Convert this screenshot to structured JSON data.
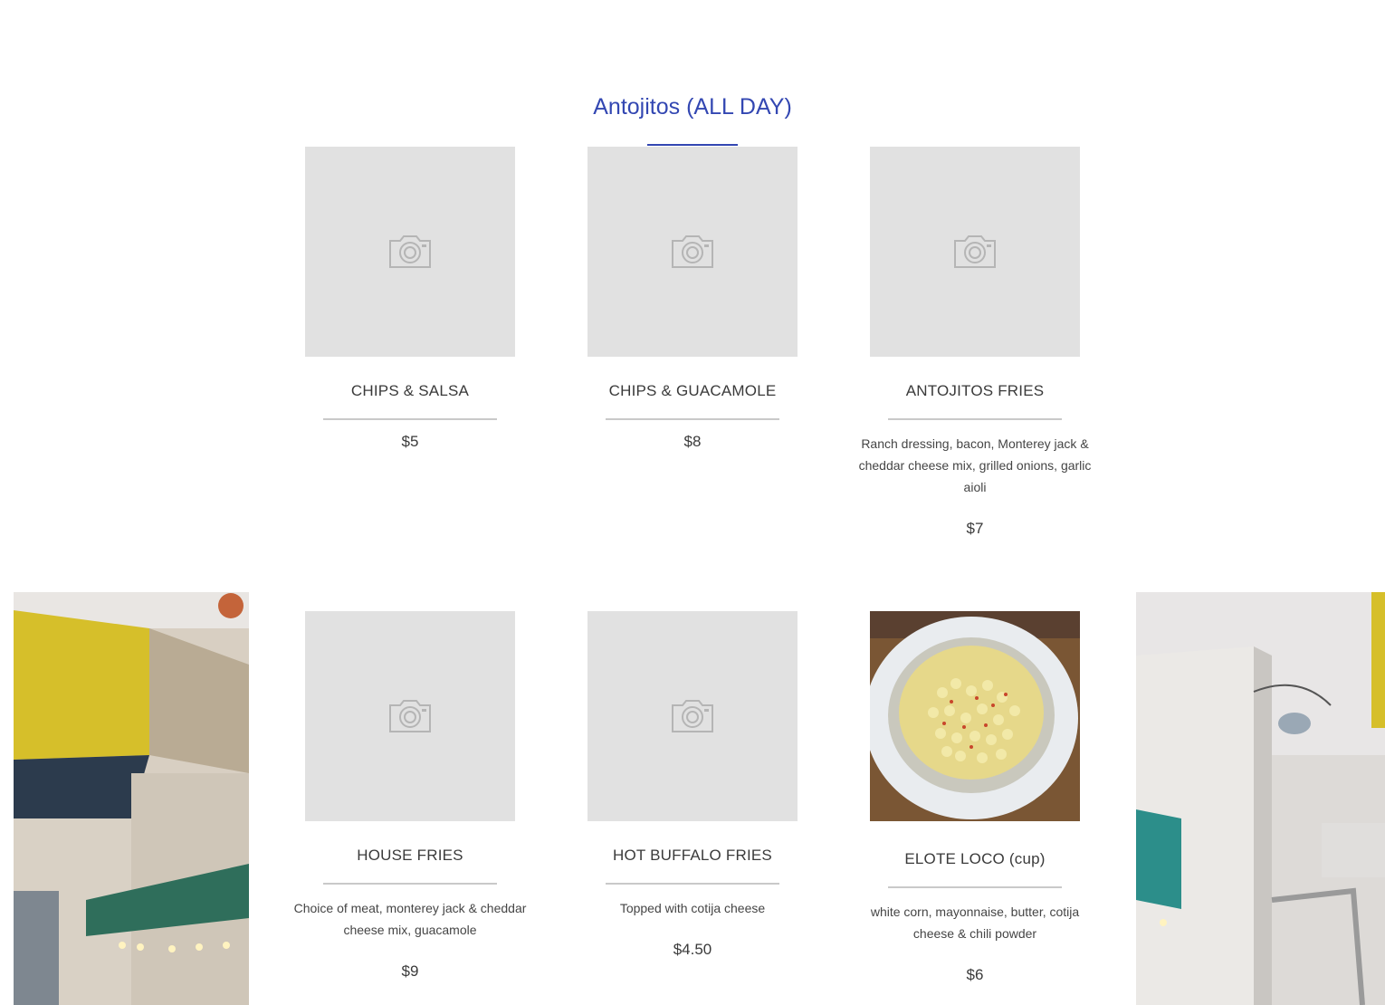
{
  "section": {
    "title": "Antojitos (ALL DAY)"
  },
  "colors": {
    "accent": "#3347b2",
    "placeholder": "#e1e1e1",
    "divider": "#c9c9c9"
  },
  "placeholder_icon": "camera-icon",
  "items": [
    {
      "name": "CHIPS & SALSA",
      "description": "",
      "price": "$5",
      "image": "camera-icon"
    },
    {
      "name": "CHIPS & GUACAMOLE",
      "description": "",
      "price": "$8",
      "image": "camera-icon"
    },
    {
      "name": "ANTOJITOS FRIES",
      "description": "Ranch dressing, bacon, Monterey jack & cheddar cheese mix, grilled onions, garlic aioli",
      "price": "$7",
      "image": "camera-icon"
    },
    {
      "name": "HOUSE FRIES",
      "description": "Choice of meat, monterey jack & cheddar cheese mix, guacamole",
      "price": "$9",
      "image": "camera-icon"
    },
    {
      "name": "HOT BUFFALO FRIES",
      "description": "Topped with cotija cheese",
      "price": "$4.50",
      "image": "camera-icon"
    },
    {
      "name": "ELOTE LOCO (cup)",
      "description": "white corn, mayonnaise, butter, cotija cheese & chili powder",
      "price": "$6",
      "image": "elote-photo"
    }
  ]
}
